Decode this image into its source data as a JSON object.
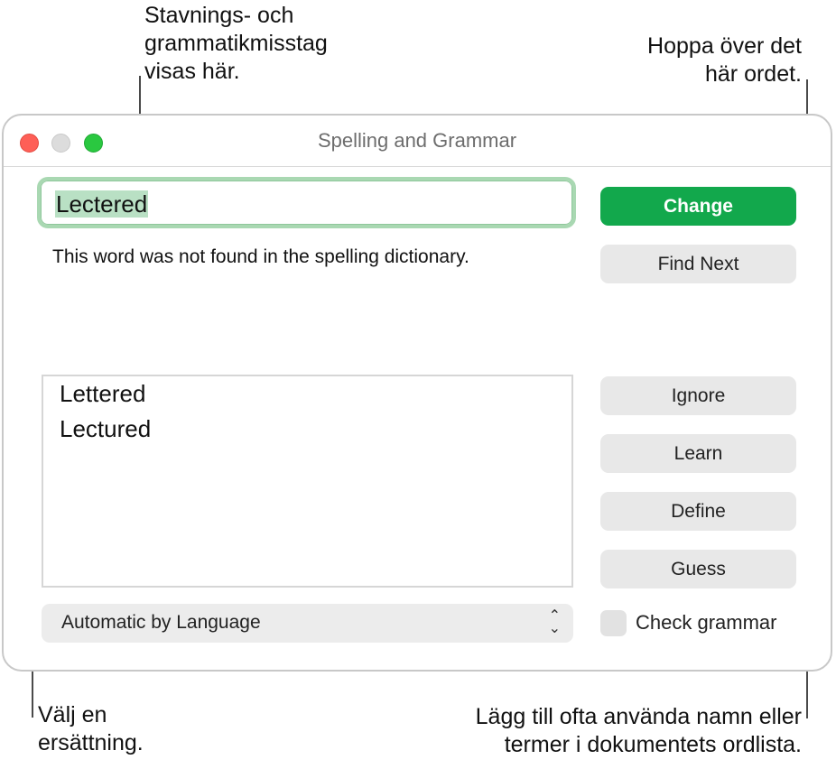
{
  "callouts": {
    "top": [
      "Stavnings- och",
      "grammatikmisstag",
      "visas här."
    ],
    "ignore": [
      "Hoppa över det",
      "här ordet."
    ],
    "choose": [
      "Välj en",
      "ersättning."
    ],
    "learn": [
      "Lägg till ofta använda namn eller",
      "termer i dokumentets ordlista."
    ]
  },
  "window": {
    "title": "Spelling and Grammar"
  },
  "word_field": {
    "value": "Lectered"
  },
  "message": "This word was not found in the spelling dictionary.",
  "suggestions": [
    "Lettered",
    "Lectured"
  ],
  "language_select": {
    "selected": "Automatic by Language"
  },
  "buttons": {
    "change": "Change",
    "find_next": "Find Next",
    "ignore": "Ignore",
    "learn": "Learn",
    "define": "Define",
    "guess": "Guess"
  },
  "check_grammar": {
    "label": "Check grammar",
    "checked": false
  },
  "colors": {
    "primary_button": "#12a84c",
    "focus_ring": "#a9d8b2",
    "close": "#fe5f57",
    "zoom": "#2ac840"
  }
}
